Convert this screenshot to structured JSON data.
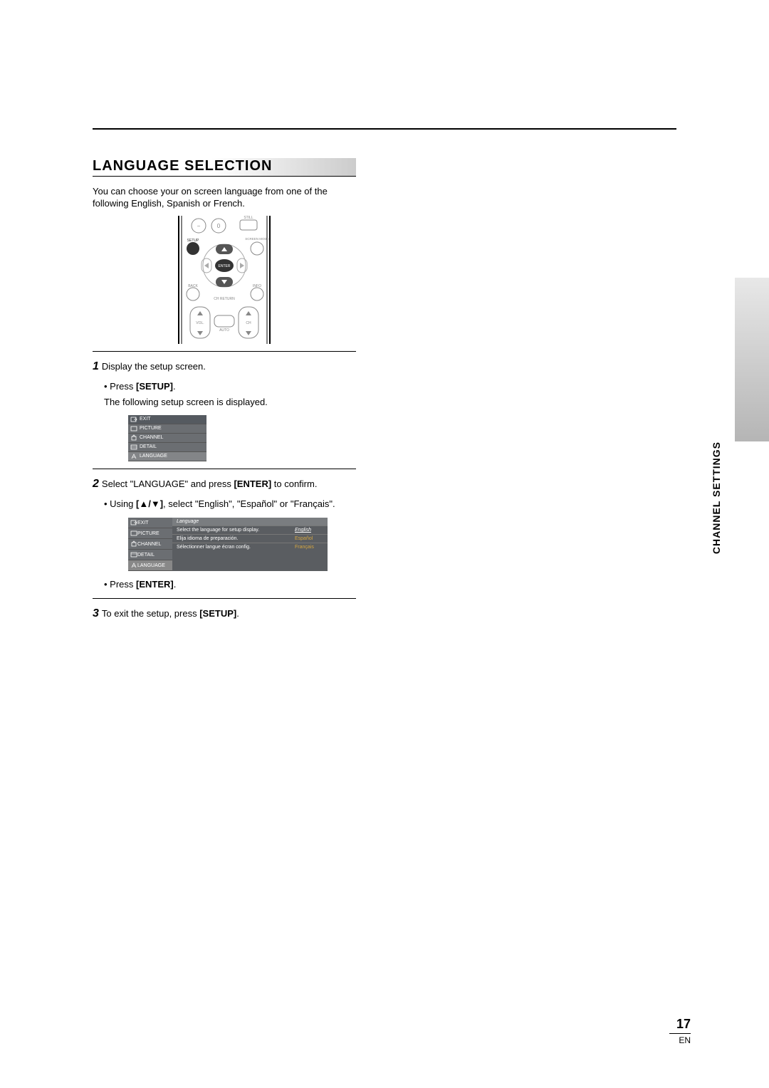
{
  "title": "LANGUAGE SELECTION",
  "intro": "You can choose your on screen language from one of the following English, Spanish or French.",
  "remote": {
    "labels": {
      "setup": "SETUP",
      "enter": "ENTER",
      "back": "BACK",
      "info": "INFO",
      "still": "STILL",
      "screen_mode": "SCREEN MODE",
      "ch_return": "CH RETURN",
      "vol": "VOL.",
      "ch": "CH",
      "zero": "0",
      "minus": "−",
      "auto": "AUTO"
    }
  },
  "step1": {
    "num": "1",
    "text": "Display the setup screen.",
    "bullet1_pre": "Press ",
    "bullet1_bold": "[SETUP]",
    "bullet1_post": ".",
    "line2": "The following setup screen is displayed."
  },
  "setup_menu": {
    "items": [
      "EXIT",
      "PICTURE",
      "CHANNEL",
      "DETAIL",
      "LANGUAGE"
    ]
  },
  "step2": {
    "num": "2",
    "text_pre": "Select \"LANGUAGE\" and press ",
    "text_bold": "[ENTER]",
    "text_post": " to confirm.",
    "bullet_pre": "Using ",
    "bullet_bold": "[▲/▼]",
    "bullet_post": ", select \"English\", \"Español\" or \"Français\"."
  },
  "lang_menu": {
    "header": "Language",
    "side": [
      "EXIT",
      "PICTURE",
      "CHANNEL",
      "DETAIL",
      "LANGUAGE"
    ],
    "rows": [
      {
        "desc": "Select the language for setup display.",
        "opt": "English",
        "selected": true
      },
      {
        "desc": "Elija idioma de preparación.",
        "opt": "Español",
        "selected": false
      },
      {
        "desc": "Sélectionner langue écran config.",
        "opt": "Français",
        "selected": false
      }
    ]
  },
  "step2b": {
    "bullet_pre": "Press ",
    "bullet_bold": "[ENTER]",
    "bullet_post": "."
  },
  "step3": {
    "num": "3",
    "text_pre": "To exit the setup, press ",
    "text_bold": "[SETUP]",
    "text_post": "."
  },
  "side_tab": "CHANNEL SETTINGS",
  "page_number": "17",
  "lang_code": "EN"
}
